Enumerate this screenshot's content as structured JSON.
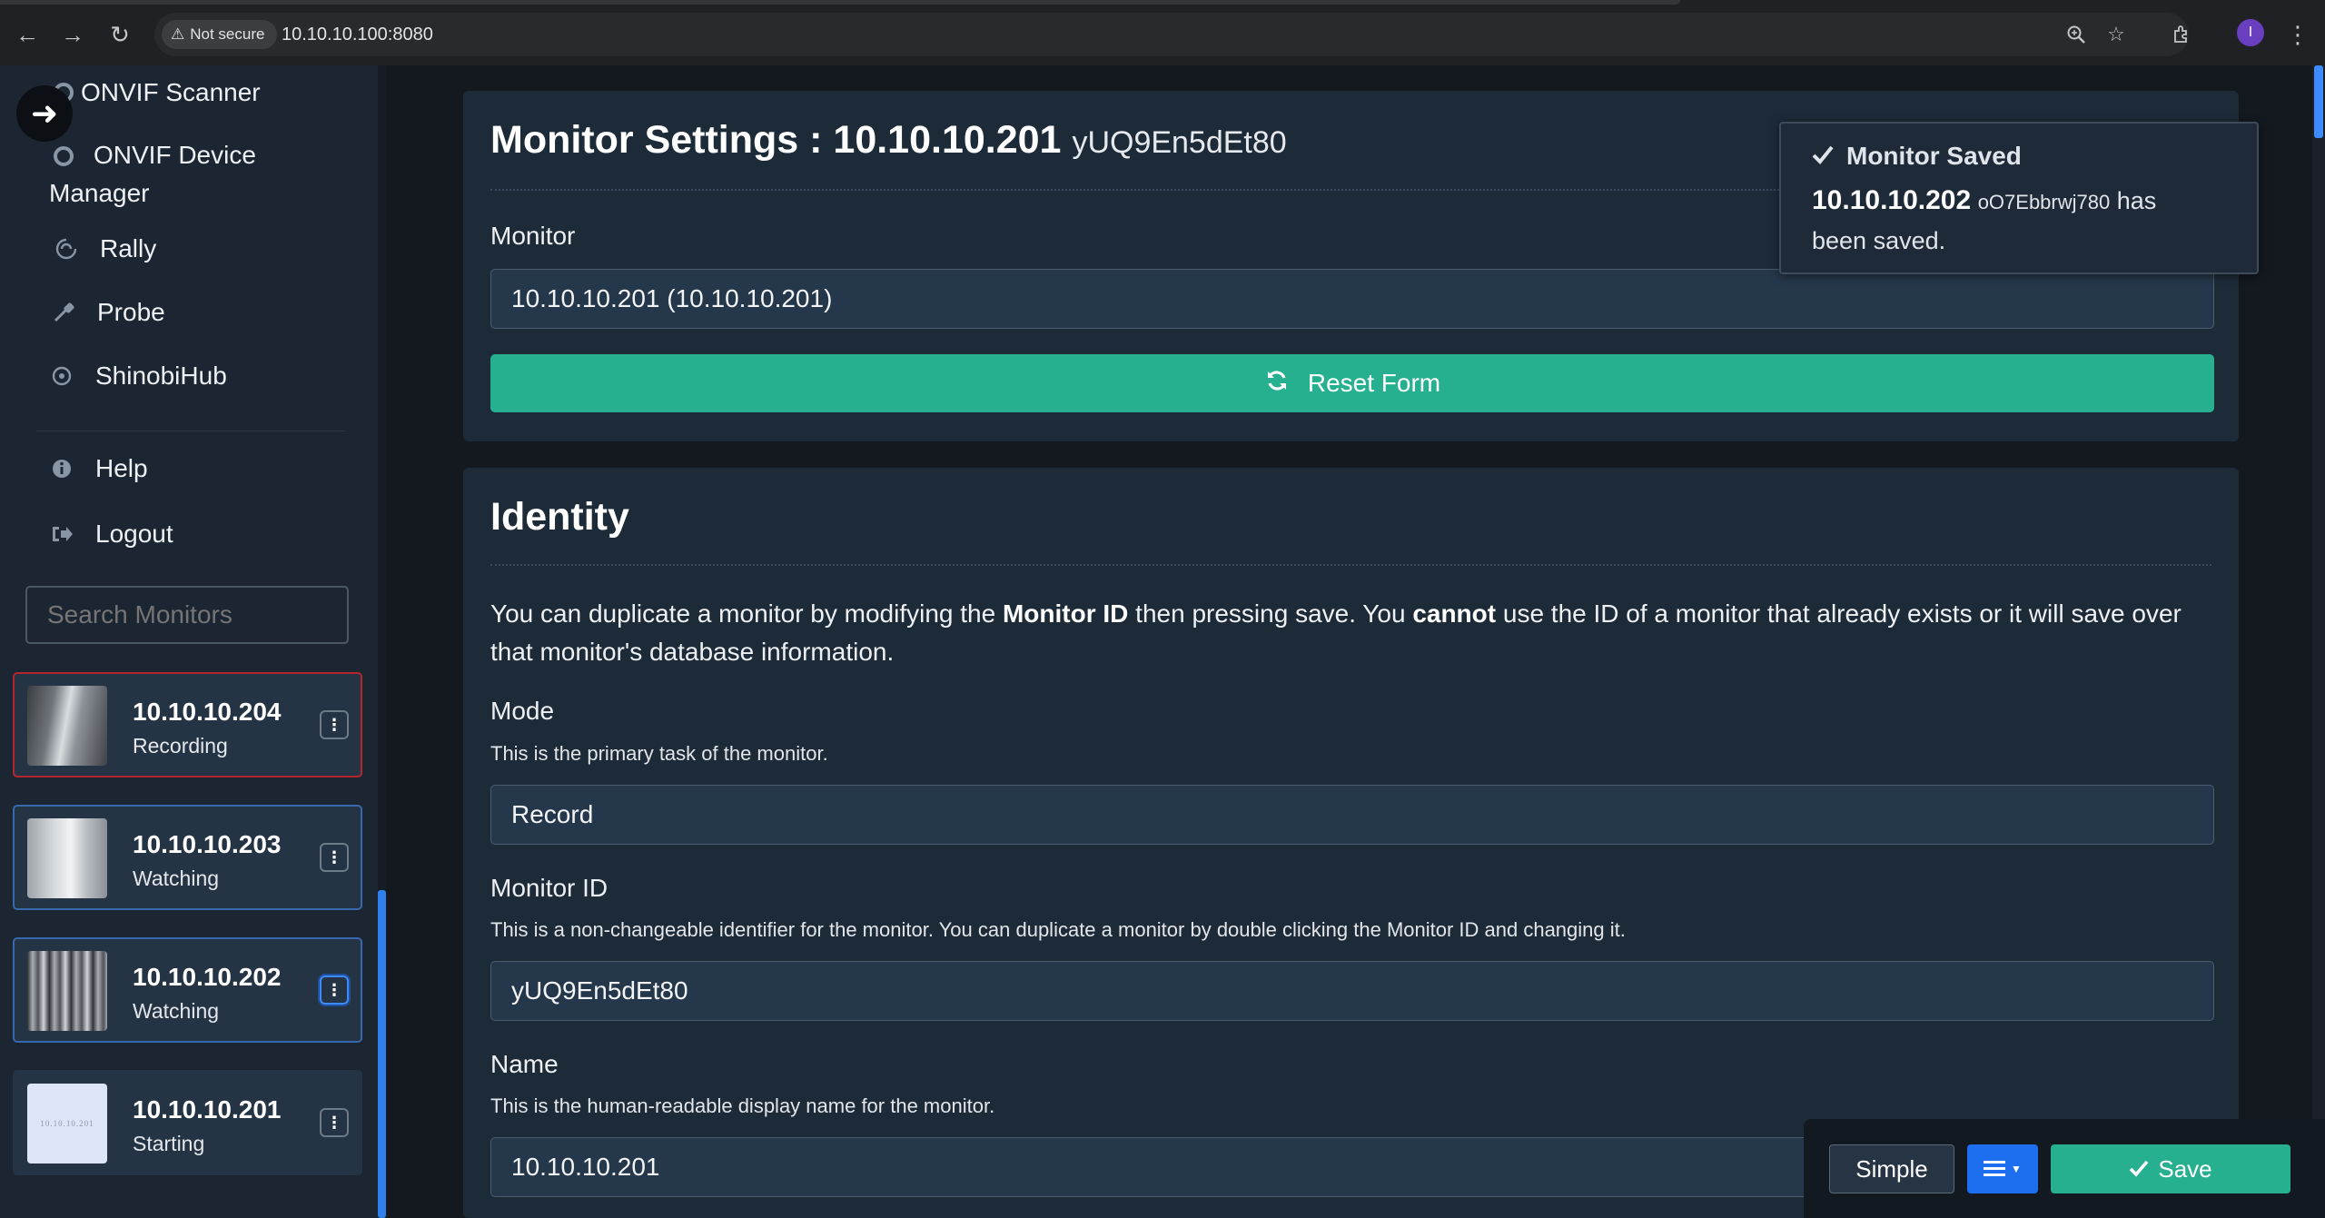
{
  "browser": {
    "security_label": "Not secure",
    "url": "10.10.10.100:8080",
    "profile_initial": "I"
  },
  "sidebar": {
    "items": [
      {
        "label": "ONVIF Scanner",
        "icon": "onvif-icon"
      },
      {
        "label": "ONVIF Device",
        "label2": "Manager",
        "icon": "onvif-icon"
      },
      {
        "label": "Rally",
        "icon": "rally-icon"
      },
      {
        "label": "Probe",
        "icon": "eyedropper-icon"
      },
      {
        "label": "ShinobiHub",
        "icon": "compass-icon"
      },
      {
        "label": "Help",
        "icon": "info-icon"
      },
      {
        "label": "Logout",
        "icon": "sign-out-icon"
      }
    ],
    "search_placeholder": "Search Monitors",
    "monitors": [
      {
        "ip": "10.10.10.204",
        "status": "Recording"
      },
      {
        "ip": "10.10.10.203",
        "status": "Watching"
      },
      {
        "ip": "10.10.10.202",
        "status": "Watching"
      },
      {
        "ip": "10.10.10.201",
        "status": "Starting",
        "thumb_text": "10.10.10.201"
      }
    ]
  },
  "settings": {
    "title": "Monitor Settings : 10.10.10.201",
    "title_id": "yUQ9En5dEt80",
    "monitor_label": "Monitor",
    "monitor_value": "10.10.10.201 (10.10.10.201)",
    "reset_label": "Reset Form"
  },
  "identity": {
    "title": "Identity",
    "para": {
      "p1": "You can duplicate a monitor by modifying the ",
      "b1": "Monitor ID",
      "p2": " then pressing save. You ",
      "b2": "cannot",
      "p3": " use the ID of a monitor that already exists or it will save over that monitor's database information."
    },
    "mode_label": "Mode",
    "mode_hint": "This is the primary task of the monitor.",
    "mode_value": "Record",
    "id_label": "Monitor ID",
    "id_hint": "This is a non-changeable identifier for the monitor. You can duplicate a monitor by double clicking the Monitor ID and changing it.",
    "id_value": "yUQ9En5dEt80",
    "name_label": "Name",
    "name_hint": "This is the human-readable display name for the monitor.",
    "name_value": "10.10.10.201"
  },
  "toast": {
    "title": "Monitor Saved",
    "ip": "10.10.10.202",
    "mid": "oO7Ebbrwj780",
    "suffix": "has",
    "line2": "been saved."
  },
  "bottombar": {
    "simple_label": "Simple",
    "save_label": "Save"
  }
}
